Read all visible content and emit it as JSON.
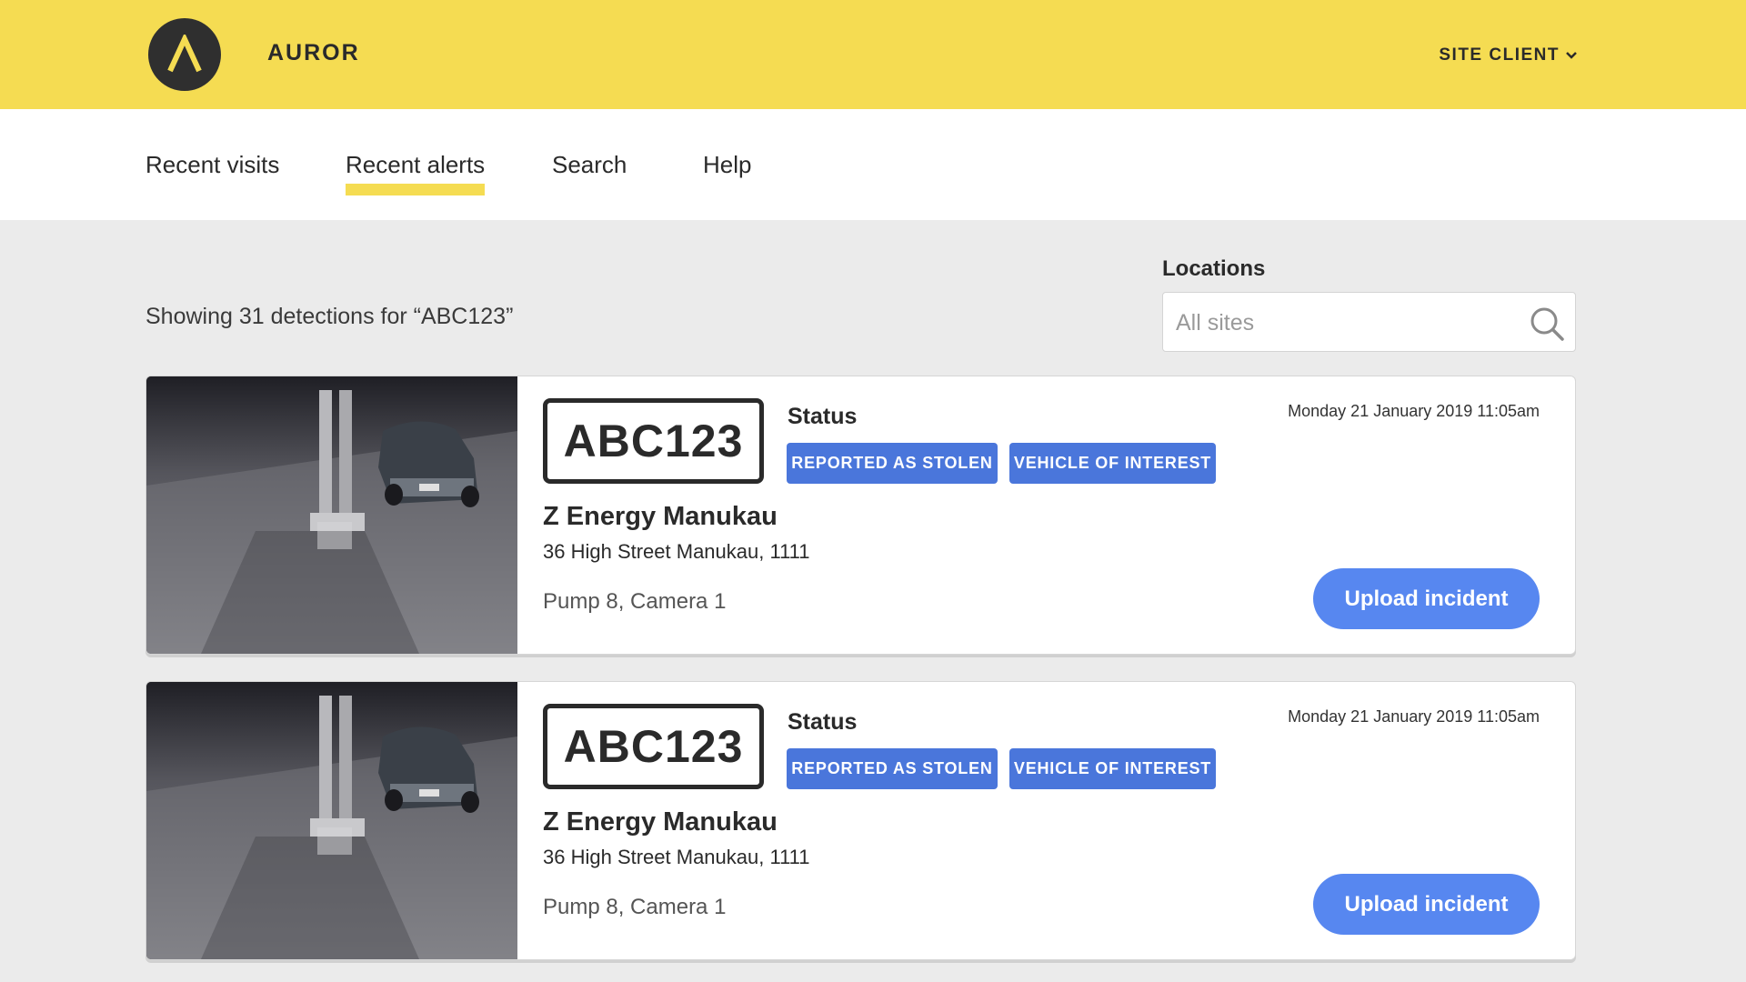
{
  "header": {
    "brand": "AUROR",
    "account_menu": "SITE CLIENT",
    "colors": {
      "bar": "#f5dc52",
      "logo": "#2f2f2f"
    }
  },
  "nav": {
    "items": [
      {
        "label": "Recent visits"
      },
      {
        "label": "Recent alerts",
        "active": true
      },
      {
        "label": "Search"
      },
      {
        "label": "Help"
      }
    ]
  },
  "results": {
    "summary": "Showing 31 detections for “ABC123”"
  },
  "filters": {
    "locations_label": "Locations",
    "locations_placeholder": "All sites"
  },
  "detections": [
    {
      "plate": "ABC123",
      "status_label": "Status",
      "badges": [
        "REPORTED AS STOLEN",
        "VEHICLE OF INTEREST"
      ],
      "datetime": "Monday 21 January 2019 11:05am",
      "site_name": "Z Energy Manukau",
      "address": "36 High Street Manukau, 1111",
      "camera": "Pump 8, Camera 1",
      "action": "Upload incident"
    },
    {
      "plate": "ABC123",
      "status_label": "Status",
      "badges": [
        "REPORTED AS STOLEN",
        "VEHICLE OF INTEREST"
      ],
      "datetime": "Monday 21 January 2019 11:05am",
      "site_name": "Z Energy Manukau",
      "address": "36 High Street Manukau, 1111",
      "camera": "Pump 8, Camera 1",
      "action": "Upload incident"
    }
  ],
  "theme": {
    "badge": "#4a76db",
    "button": "#5787f0",
    "background": "#ebebeb"
  }
}
